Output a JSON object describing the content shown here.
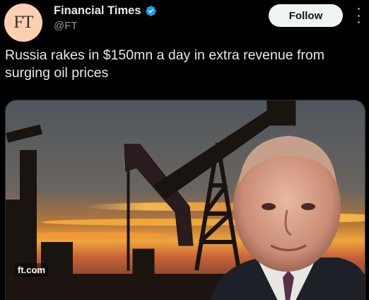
{
  "author": {
    "display_name": "Financial Times",
    "handle": "@FT",
    "avatar_text": "FT",
    "verified_icon": "verified-badge-icon"
  },
  "actions": {
    "follow_label": "Follow",
    "more_icon": "more-options-icon"
  },
  "tweet": {
    "text": "Russia rakes in $150mn a day in extra revenue from surging oil prices"
  },
  "media_card": {
    "domain": "ft.com",
    "image_subject": "photo"
  },
  "colors": {
    "background": "#000000",
    "text": "#e7e9ea",
    "secondary_text": "#8b98a5",
    "verified": "#1d9bf0",
    "avatar_bg": "#fcd0b1",
    "follow_bg": "#eff3f4"
  }
}
